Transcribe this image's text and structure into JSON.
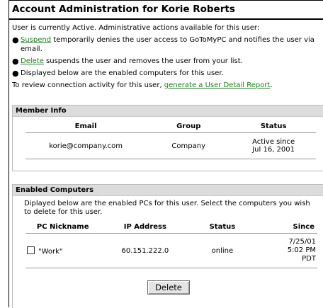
{
  "title": "Account Administration for Korie Roberts",
  "intro": {
    "status_line": "User is currently Active. Administrative actions available for this user:",
    "bullets": [
      {
        "link": "Suspend",
        "text": " temporarily denies the user access to GoToMyPC and notifies the user via email."
      },
      {
        "link": "Delete",
        "text": " suspends the user and removes the user from your list."
      },
      {
        "link": "",
        "text": "Displayed below are the enabled computers for this user."
      }
    ],
    "review_prefix": "To review connection activity for this user, ",
    "review_link": "generate a User Detail Report",
    "review_suffix": "."
  },
  "member_info": {
    "heading": "Member Info",
    "columns": [
      "Email",
      "Group",
      "Status"
    ],
    "row": {
      "email": "korie@company.com",
      "group": "Company",
      "status_line1": "Active since",
      "status_line2": "Jul 16, 2001"
    }
  },
  "enabled_computers": {
    "heading": "Enabled Computers",
    "description": "Diplayed below are the enabled PCs for this user. Select the computers you wish to delete for this user.",
    "columns": [
      "PC Nickname",
      "IP Address",
      "Status",
      "Since"
    ],
    "row": {
      "nickname": "\"Work\"",
      "ip": "60.151.222.0",
      "status": "online",
      "since_line1": "7/25/01",
      "since_line2": "5:02 PM",
      "since_line3": "PDT"
    },
    "delete_label": "Delete"
  }
}
